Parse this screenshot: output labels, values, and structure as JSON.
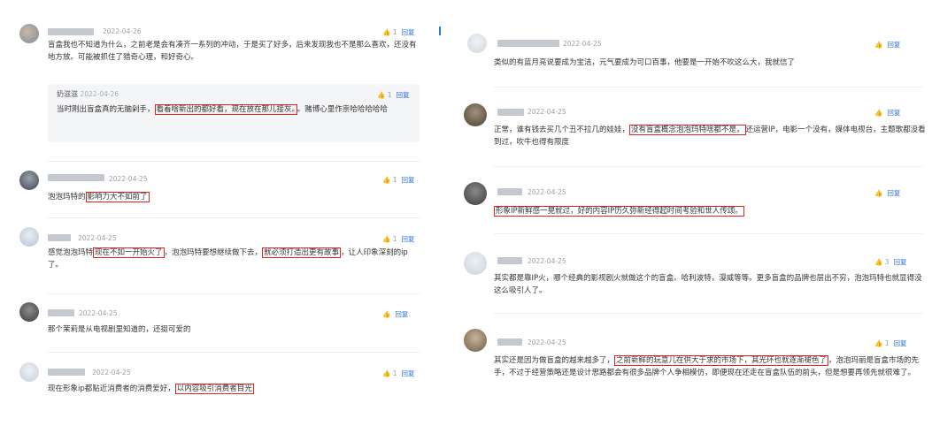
{
  "colors": {
    "accent": "#2b6fd6",
    "highlight_border": "#e0231c",
    "reply_bg": "#f4f5f7"
  },
  "like_icon": "thumbs-up-icon",
  "left": {
    "c1": {
      "date": "2022-04-26",
      "likes": "1",
      "reply": "回复",
      "text": "盲盒我也不知道为什么，之前老是会有凑齐一系列的冲动，于是买了好多，后来发现我也不是那么喜欢，还没有地方放。可能被抓住了猎奇心理，和好奇心。"
    },
    "c1_reply": {
      "name": "奶滋滋",
      "date": "2022-04-26",
      "likes": "1",
      "reply": "回复",
      "t1": "当时刚出盲盒真的无脑剁手，",
      "h1": "看着啥新出的都好看，现在放在那儿接灰。",
      "t2": "。赌博心里作祟哈哈哈哈哈"
    },
    "c2": {
      "date": "2022-04-25",
      "likes": "1",
      "reply": "回复",
      "t1": "泡泡玛特的",
      "h1": "影响力大不如前了",
      "t2": ""
    },
    "c3": {
      "date": "2022-04-25",
      "likes": "1",
      "reply": "回复",
      "t1": "感觉泡泡玛特",
      "h1": "现在不如一开始火了",
      "t2": "，泡泡玛特要想继续做下去，",
      "h2": "就必须打造出更有故事",
      "t3": "，让人印象深刻的ip了。"
    },
    "c4": {
      "date": "2022-04-25",
      "likes": "",
      "reply": "回复",
      "text": "那个茉莉是从电视剧里知道的，还挺可爱的"
    },
    "c5": {
      "date": "2022-04-25",
      "likes": "1",
      "reply": "回复",
      "t1": "现在形象ip都贴近消费者的消费爱好，",
      "h1": "以内容吸引消费者目光"
    }
  },
  "right": {
    "c1": {
      "date": "2022-04-25",
      "likes": "",
      "reply": "回复",
      "text": "类似的有蓝月亮说要成为宝洁，元气要成为可口百事，他要是一开始不吹这么大，我就信了"
    },
    "c2": {
      "date": "2022-04-25",
      "likes": "",
      "reply": "回复",
      "t1": "正常，谁有钱去买几个丑不拉几的娃娃，",
      "h1": "没有盲盒概念泡泡玛特啥都不是，",
      "t2": "还运营IP，电影一个没有，媒体电视台，主题歌都没看到过，吹牛也得有限度"
    },
    "c3": {
      "date": "2022-04-25",
      "likes": "",
      "reply": "回复",
      "h1": "形象IP新鲜感一晃就过，好的内容IP历久弥新经得起时间考验和世人传颂。"
    },
    "c4": {
      "date": "2022-04-25",
      "likes": "3",
      "reply": "回复",
      "text": "其实都是靠IP火，哪个经典的影视剧火就做这个的盲盒。哈利波特，漫威等等。更多盲盒的品牌也层出不穷，泡泡玛特也就显得没这么吸引人了。"
    },
    "c5": {
      "date": "2022-04-25",
      "likes": "1",
      "reply": "回复",
      "t1": "其实还是因为做盲盒的越来越多了，",
      "h1": "之前新鲜的玩意儿在供大于求的市场下，其光环也就逐渐褪色了",
      "t2": "，泡泡玛丽是盲盒市场的先手，不过于经营策略还是设计思路都会有很多品牌个人争相模仿，即便现在还走在盲盒队伍的前头，但是想要再领先就很难了。"
    }
  }
}
